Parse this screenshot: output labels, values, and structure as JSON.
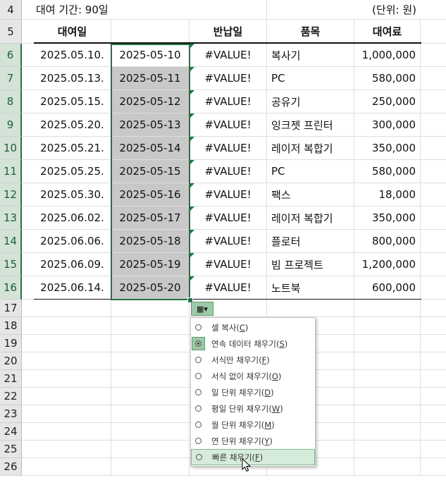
{
  "title_cells": {
    "loan_period": "대여 기간: 90일",
    "unit": "(단위: 원)"
  },
  "headers": {
    "loan_date": "대여일",
    "blank": "",
    "return_date": "반납일",
    "item": "품목",
    "fee": "대여료"
  },
  "rows": [
    {
      "num": "6",
      "loan": "2025.05.10.",
      "filled": "2025-05-10",
      "ret": "#VALUE!",
      "item": "복사기",
      "fee": "1,000,000"
    },
    {
      "num": "7",
      "loan": "2025.05.13.",
      "filled": "2025-05-11",
      "ret": "#VALUE!",
      "item": "PC",
      "fee": "580,000"
    },
    {
      "num": "8",
      "loan": "2025.05.15.",
      "filled": "2025-05-12",
      "ret": "#VALUE!",
      "item": "공유기",
      "fee": "250,000"
    },
    {
      "num": "9",
      "loan": "2025.05.20.",
      "filled": "2025-05-13",
      "ret": "#VALUE!",
      "item": "잉크젯 프린터",
      "fee": "300,000"
    },
    {
      "num": "10",
      "loan": "2025.05.21.",
      "filled": "2025-05-14",
      "ret": "#VALUE!",
      "item": "레이저 복합기",
      "fee": "350,000"
    },
    {
      "num": "11",
      "loan": "2025.05.25.",
      "filled": "2025-05-15",
      "ret": "#VALUE!",
      "item": "PC",
      "fee": "580,000"
    },
    {
      "num": "12",
      "loan": "2025.05.30.",
      "filled": "2025-05-16",
      "ret": "#VALUE!",
      "item": "팩스",
      "fee": "18,000"
    },
    {
      "num": "13",
      "loan": "2025.06.02.",
      "filled": "2025-05-17",
      "ret": "#VALUE!",
      "item": "레이저 복합기",
      "fee": "350,000"
    },
    {
      "num": "14",
      "loan": "2025.06.06.",
      "filled": "2025-05-18",
      "ret": "#VALUE!",
      "item": "플로터",
      "fee": "800,000"
    },
    {
      "num": "15",
      "loan": "2025.06.09.",
      "filled": "2025-05-19",
      "ret": "#VALUE!",
      "item": "빔 프로젝트",
      "fee": "1,200,000"
    },
    {
      "num": "16",
      "loan": "2025.06.14.",
      "filled": "2025-05-20",
      "ret": "#VALUE!",
      "item": "노트북",
      "fee": "600,000"
    }
  ],
  "row_numbers": {
    "top": [
      "4",
      "5"
    ],
    "bottom": [
      "17",
      "18",
      "19",
      "20",
      "21",
      "22",
      "23",
      "24",
      "25",
      "26"
    ]
  },
  "autofill_menu": {
    "items": [
      {
        "label": "셀 복사(",
        "key": "C",
        "end": ")",
        "checked": false
      },
      {
        "label": "연속 데이터 채우기(",
        "key": "S",
        "end": ")",
        "checked": true
      },
      {
        "label": "서식만 채우기(",
        "key": "F",
        "end": ")",
        "checked": false
      },
      {
        "label": "서식 없이 채우기(",
        "key": "O",
        "end": ")",
        "checked": false
      },
      {
        "label": "일 단위 채우기(",
        "key": "D",
        "end": ")",
        "checked": false
      },
      {
        "label": "평일 단위 채우기(",
        "key": "W",
        "end": ")",
        "checked": false
      },
      {
        "label": "월 단위 채우기(",
        "key": "M",
        "end": ")",
        "checked": false
      },
      {
        "label": "연 단위 채우기(",
        "key": "Y",
        "end": ")",
        "checked": false
      },
      {
        "label": "빠른 채우기(",
        "key": "F",
        "end": ")",
        "checked": false,
        "hover": true
      }
    ]
  },
  "colors": {
    "accent": "#217346",
    "selection_fill": "#c8c8c8",
    "error_triangle": "#1e7a3c"
  }
}
